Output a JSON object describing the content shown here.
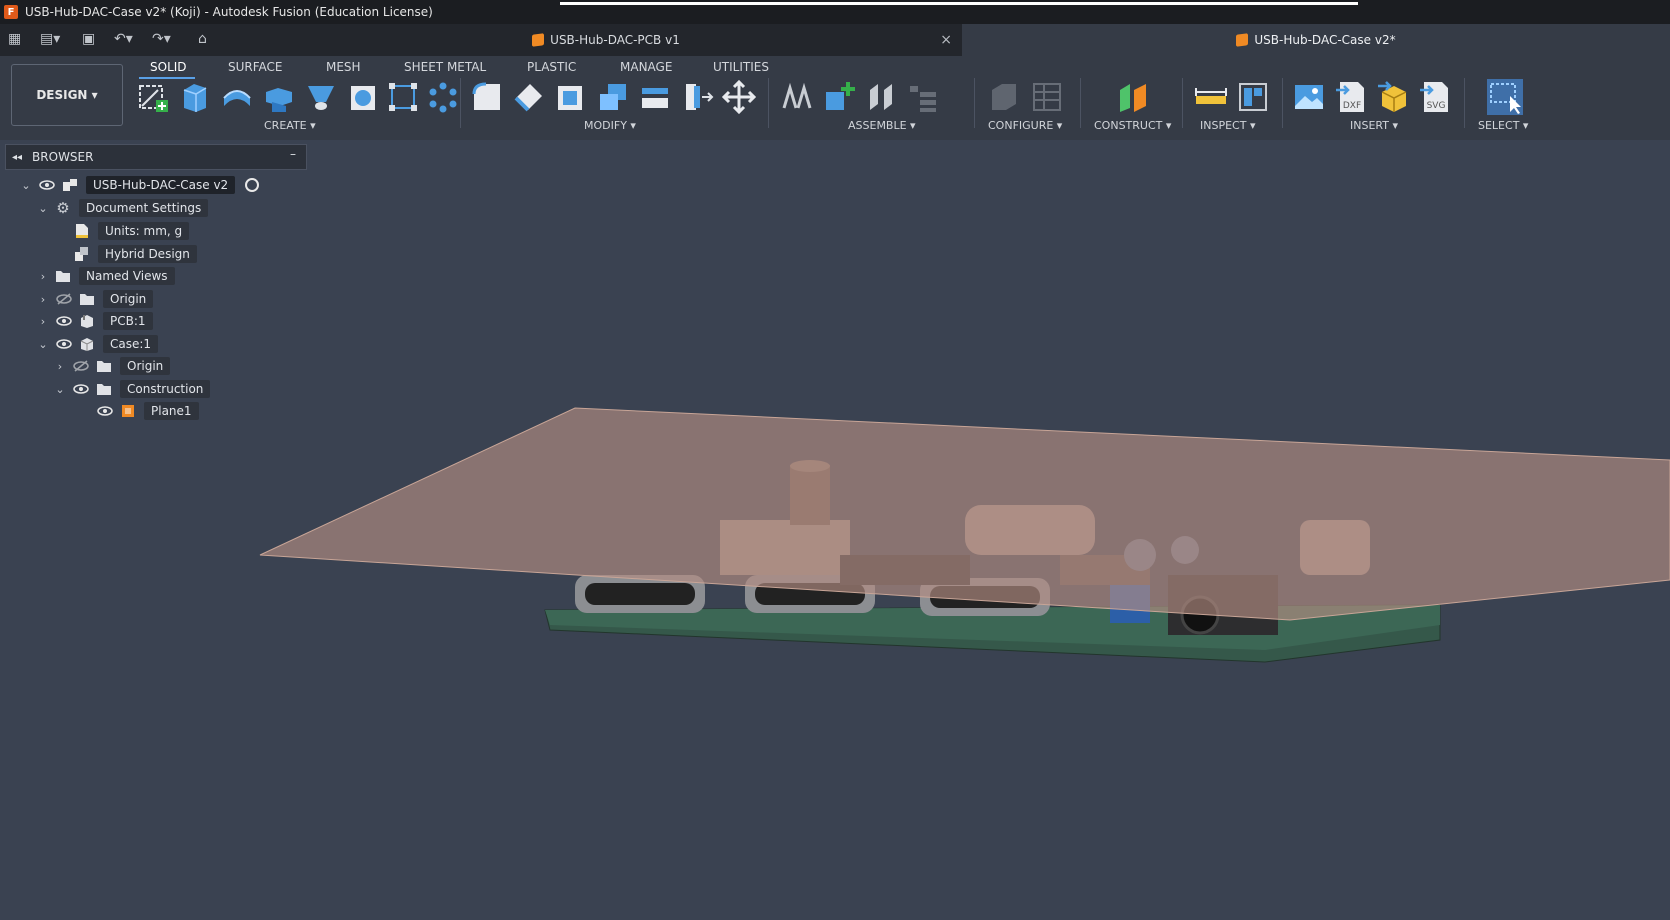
{
  "window": {
    "title": "USB-Hub-DAC-Case v2* (Koji) - Autodesk Fusion (Education License)",
    "app_icon": "F"
  },
  "tabs": [
    {
      "label": "USB-Hub-DAC-PCB v1",
      "close_icon": "×"
    },
    {
      "label": "USB-Hub-DAC-Case v2*"
    }
  ],
  "toolbar": {
    "workspace": "DESIGN",
    "workspace_tabs": [
      "SOLID",
      "SURFACE",
      "MESH",
      "SHEET METAL",
      "PLASTIC",
      "MANAGE",
      "UTILITIES"
    ],
    "groups": [
      "CREATE",
      "MODIFY",
      "ASSEMBLE",
      "CONFIGURE",
      "CONSTRUCT",
      "INSPECT",
      "INSERT",
      "SELECT"
    ],
    "insert_icons": {
      "dxf": "DXF",
      "svg": "SVG"
    }
  },
  "browser": {
    "title": "BROWSER",
    "collapse_icon": "–",
    "items": [
      {
        "label": "USB-Hub-DAC-Case v2"
      },
      {
        "label": "Document Settings"
      },
      {
        "label": "Units: mm, g"
      },
      {
        "label": "Hybrid Design"
      },
      {
        "label": "Named Views"
      },
      {
        "label": "Origin"
      },
      {
        "label": "PCB:1"
      },
      {
        "label": "Case:1"
      },
      {
        "label": "Origin"
      },
      {
        "label": "Construction"
      },
      {
        "label": "Plane1"
      }
    ]
  },
  "colors": {
    "accent": "#5aa0e6",
    "plane": "#b48e82",
    "pcb": "#35584a"
  }
}
